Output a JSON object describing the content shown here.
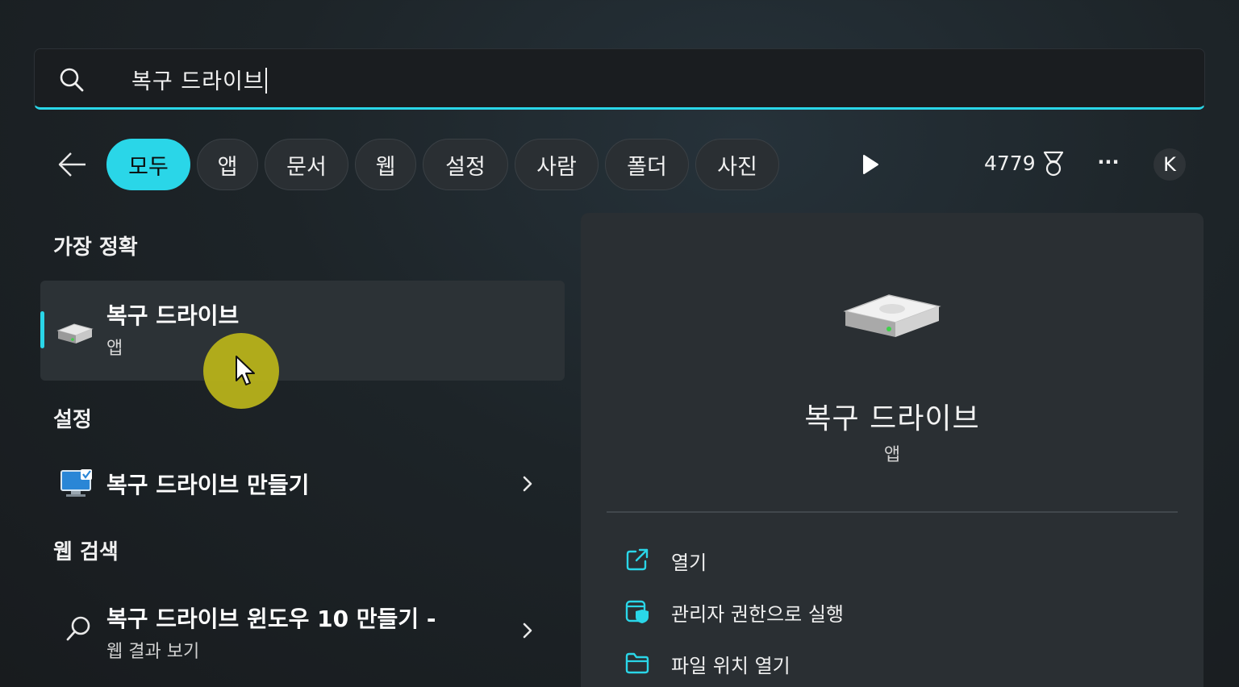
{
  "search": {
    "query": "복구 드라이브"
  },
  "filters": {
    "chips": [
      "모두",
      "앱",
      "문서",
      "웹",
      "설정",
      "사람",
      "폴더",
      "사진"
    ],
    "active_index": 0,
    "points": "4779",
    "avatar_initial": "K"
  },
  "best_match": {
    "section_title": "가장 정확",
    "name": "복구 드라이브",
    "type": "앱"
  },
  "settings": {
    "section_title": "설정",
    "item_label": "복구 드라이브 만들기"
  },
  "web": {
    "section_title": "웹 검색",
    "item_label": "복구 드라이브 윈도우 10 만들기 -",
    "item_sub": "웹 결과 보기"
  },
  "preview": {
    "name": "복구 드라이브",
    "type": "앱",
    "actions": [
      "열기",
      "관리자 권한으로 실행",
      "파일 위치 열기"
    ]
  },
  "colors": {
    "accent": "#2ad6e8",
    "cursor_halo": "#b7b21a"
  }
}
